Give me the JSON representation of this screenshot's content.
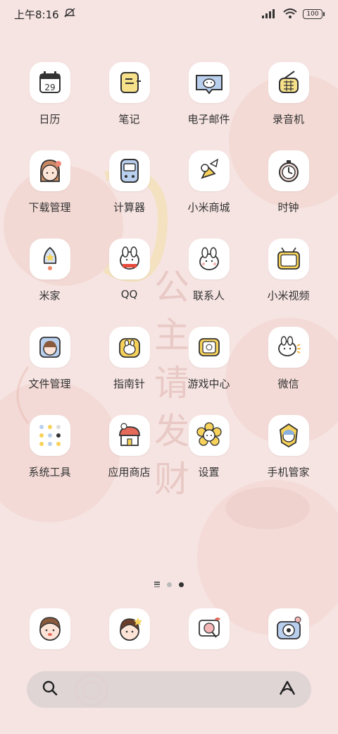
{
  "status_bar": {
    "time": "上午8:16",
    "battery": "100"
  },
  "apps": [
    {
      "label": "日历",
      "icon": "calendar-icon",
      "date": "29"
    },
    {
      "label": "笔记",
      "icon": "notes-icon"
    },
    {
      "label": "电子邮件",
      "icon": "email-icon"
    },
    {
      "label": "录音机",
      "icon": "recorder-icon"
    },
    {
      "label": "下载管理",
      "icon": "download-manager-icon"
    },
    {
      "label": "计算器",
      "icon": "calculator-icon"
    },
    {
      "label": "小米商城",
      "icon": "mi-store-icon"
    },
    {
      "label": "时钟",
      "icon": "clock-icon"
    },
    {
      "label": "米家",
      "icon": "mijia-icon"
    },
    {
      "label": "QQ",
      "icon": "qq-icon"
    },
    {
      "label": "联系人",
      "icon": "contacts-icon"
    },
    {
      "label": "小米视频",
      "icon": "mi-video-icon"
    },
    {
      "label": "文件管理",
      "icon": "file-manager-icon"
    },
    {
      "label": "指南针",
      "icon": "compass-icon"
    },
    {
      "label": "游戏中心",
      "icon": "game-center-icon"
    },
    {
      "label": "微信",
      "icon": "wechat-icon"
    },
    {
      "label": "系统工具",
      "icon": "system-tools-folder-icon"
    },
    {
      "label": "应用商店",
      "icon": "app-store-icon"
    },
    {
      "label": "设置",
      "icon": "settings-icon"
    },
    {
      "label": "手机管家",
      "icon": "security-icon"
    }
  ],
  "dock": [
    {
      "icon": "phone-icon"
    },
    {
      "icon": "messages-icon"
    },
    {
      "icon": "browser-icon"
    },
    {
      "icon": "camera-icon"
    }
  ],
  "wallpaper_text": "公主请发财",
  "colors": {
    "background": "#f6e4e2",
    "icon_bg": "#ffffff",
    "accent_yellow": "#f7e08a",
    "accent_blue": "#b9cfee",
    "accent_pink": "#f4b6b6"
  }
}
